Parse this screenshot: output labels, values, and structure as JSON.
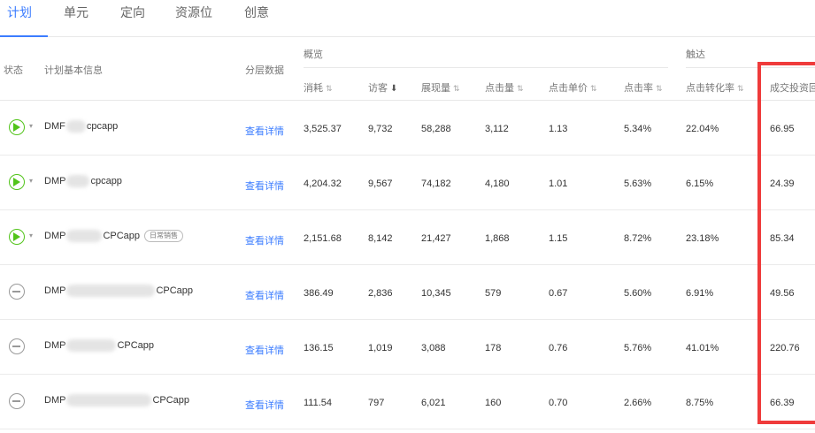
{
  "tabs": [
    {
      "label": "计划",
      "active": true
    },
    {
      "label": "单元",
      "active": false
    },
    {
      "label": "定向",
      "active": false
    },
    {
      "label": "资源位",
      "active": false
    },
    {
      "label": "创意",
      "active": false
    }
  ],
  "headers": {
    "status": "状态",
    "plan_info": "计划基本信息",
    "layer_data": "分层数据",
    "group_overview": "概览",
    "group_reach": "触达",
    "cost": "消耗",
    "visitors": "访客",
    "impressions": "展现量",
    "clicks": "点击量",
    "cpc": "点击单价",
    "ctr": "点击率",
    "conversion": "点击转化率",
    "roi": "成交投资回"
  },
  "sort_icons": {
    "neutral": "⇅",
    "desc": "⬇"
  },
  "detail_label": "查看详情",
  "colors": {
    "accent": "#3b7cff",
    "running": "#52c41a",
    "paused": "#999999",
    "highlight": "#ef3b3b"
  },
  "rows": [
    {
      "status": "running",
      "name_prefix": "DMF",
      "name_suffix": "cpcapp",
      "tag": "",
      "cost": "3,525.37",
      "visitors": "9,732",
      "impressions": "58,288",
      "clicks": "3,112",
      "cpc": "1.13",
      "ctr": "5.34%",
      "conversion": "22.04%",
      "roi": "66.95"
    },
    {
      "status": "running",
      "name_prefix": "DMP",
      "name_suffix": "cpcapp",
      "tag": "",
      "cost": "4,204.32",
      "visitors": "9,567",
      "impressions": "74,182",
      "clicks": "4,180",
      "cpc": "1.01",
      "ctr": "5.63%",
      "conversion": "6.15%",
      "roi": "24.39"
    },
    {
      "status": "running",
      "name_prefix": "DMP",
      "name_suffix": "CPCapp",
      "tag": "日常销售",
      "cost": "2,151.68",
      "visitors": "8,142",
      "impressions": "21,427",
      "clicks": "1,868",
      "cpc": "1.15",
      "ctr": "8.72%",
      "conversion": "23.18%",
      "roi": "85.34"
    },
    {
      "status": "paused",
      "name_prefix": "DMP",
      "name_suffix": "CPCapp",
      "tag": "",
      "cost": "386.49",
      "visitors": "2,836",
      "impressions": "10,345",
      "clicks": "579",
      "cpc": "0.67",
      "ctr": "5.60%",
      "conversion": "6.91%",
      "roi": "49.56"
    },
    {
      "status": "paused",
      "name_prefix": "DMP",
      "name_suffix": "CPCapp",
      "tag": "",
      "cost": "136.15",
      "visitors": "1,019",
      "impressions": "3,088",
      "clicks": "178",
      "cpc": "0.76",
      "ctr": "5.76%",
      "conversion": "41.01%",
      "roi": "220.76"
    },
    {
      "status": "paused",
      "name_prefix": "DMP",
      "name_suffix": "CPCapp",
      "tag": "",
      "cost": "111.54",
      "visitors": "797",
      "impressions": "6,021",
      "clicks": "160",
      "cpc": "0.70",
      "ctr": "2.66%",
      "conversion": "8.75%",
      "roi": "66.39"
    }
  ]
}
